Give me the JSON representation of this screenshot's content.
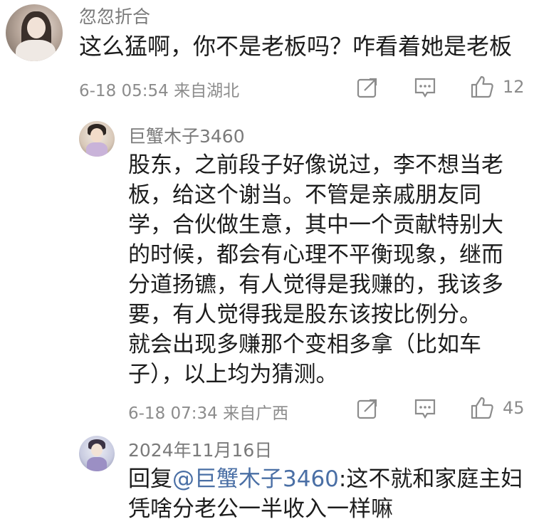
{
  "comment1": {
    "username": "忽忽折合",
    "text": "这么猛啊，你不是老板吗？咋看着她是老板",
    "time": "6-18 05:54",
    "location": "来自湖北",
    "likes": "12"
  },
  "reply1": {
    "username": "巨蟹木子3460",
    "lines": [
      "股东，之前段子好像说过，李不想当老",
      "板，给这个谢当。不管是亲戚朋友同",
      "学，合伙做生意，其中一个贡献特别大",
      "的时候，都会有心理不平衡现象，继而",
      "分道扬镳，有人觉得是我赚的，我该多",
      "要，有人觉得我是股东该按比例分。",
      "就会出现多赚那个变相多拿（比如车",
      "子），以上均为猜测。"
    ],
    "time": "6-18 07:34",
    "location": "来自广西",
    "likes": "45"
  },
  "reply2": {
    "date": "2024年11月16日",
    "prefix": "回复",
    "mention": "@巨蟹木子3460",
    "line1_rest": ":这不就和家庭主妇",
    "line2": "凭啥分老公一半收入一样嘛"
  },
  "icons": {
    "share": "share-icon",
    "comment": "comment-icon",
    "like": "thumbs-up-icon"
  }
}
